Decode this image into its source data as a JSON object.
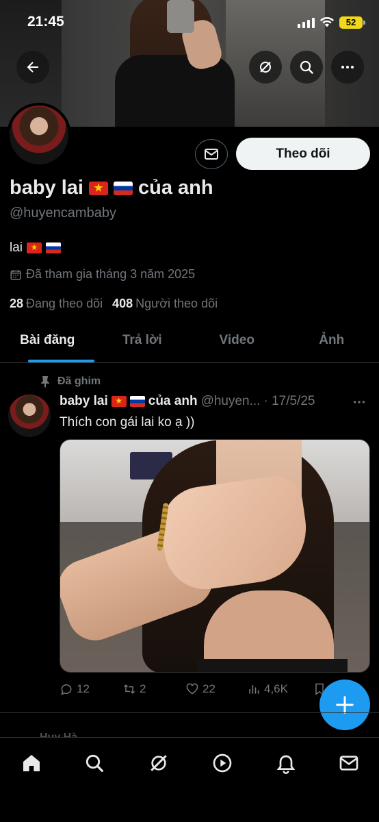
{
  "status_bar": {
    "time": "21:45",
    "battery": "52"
  },
  "profile": {
    "display_name": "baby lai",
    "name_suffix": "của anh",
    "handle": "@huyencambaby",
    "bio_text": "lai",
    "joined": "Đã tham gia tháng 3 năm 2025",
    "following_count": "28",
    "following_label": "Đang theo dõi",
    "followers_count": "408",
    "followers_label": "Người theo dõi",
    "follow_button": "Theo dõi"
  },
  "tabs": [
    {
      "label": "Bài đăng",
      "active": true
    },
    {
      "label": "Trả lời",
      "active": false
    },
    {
      "label": "Video",
      "active": false
    },
    {
      "label": "Ảnh",
      "active": false
    }
  ],
  "pinned_post": {
    "pinned_label": "Đã ghim",
    "author_name": "baby lai",
    "author_suffix": "của anh",
    "author_handle": "@huyen...",
    "date": "· 17/5/25",
    "text": "Thích con gái lai ko ạ ))",
    "replies": "12",
    "reposts": "2",
    "likes": "22",
    "views": "4,6K"
  },
  "next_post_peek": "Huy Hà",
  "icons": {
    "back": "arrow-left-icon",
    "grok": "grok-icon",
    "search": "search-icon",
    "more": "more-horizontal-icon",
    "message": "envelope-icon",
    "calendar": "calendar-icon",
    "pin": "pin-icon",
    "reply": "reply-icon",
    "repost": "repost-icon",
    "like": "heart-icon",
    "views": "views-icon",
    "bookmark": "bookmark-icon",
    "compose": "plus-icon",
    "nav_home": "home-icon",
    "nav_search": "search-icon",
    "nav_grok": "grok-icon",
    "nav_video": "play-icon",
    "nav_notifications": "bell-icon",
    "nav_messages": "envelope-icon"
  },
  "colors": {
    "accent": "#1d9bf0",
    "background": "#000000",
    "muted": "#71767b",
    "battery": "#f2d81a"
  }
}
